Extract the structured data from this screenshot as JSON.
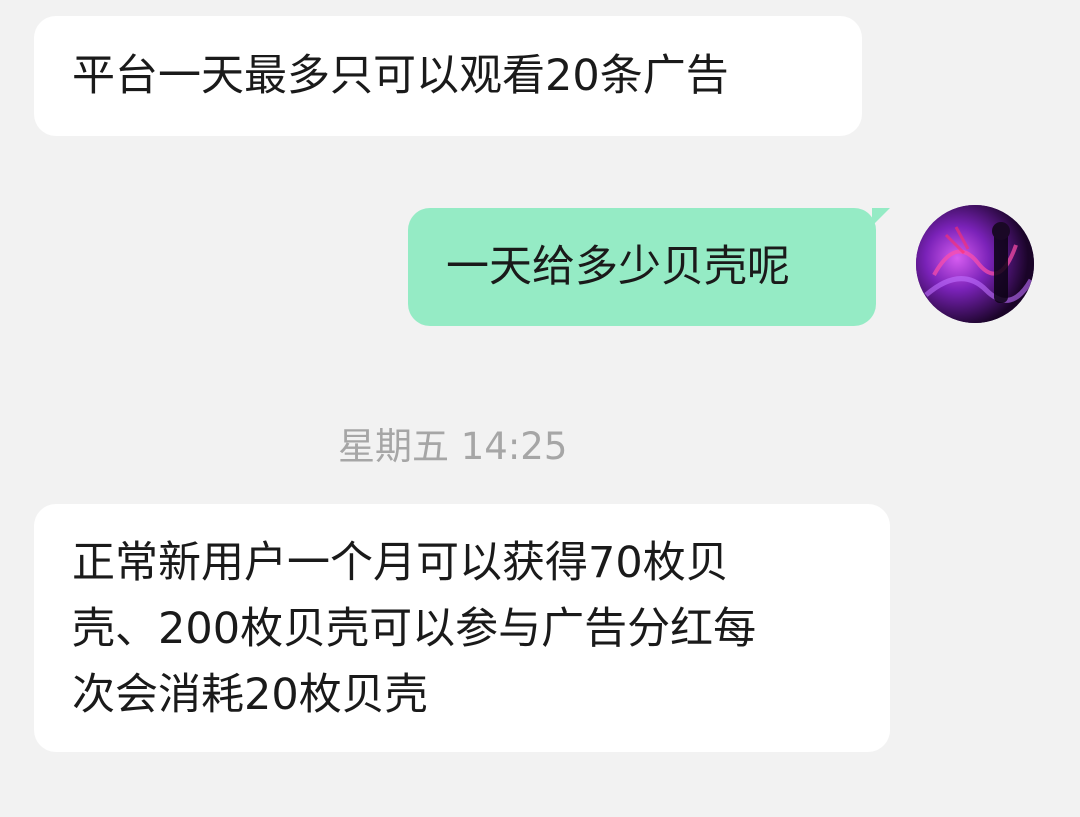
{
  "messages": [
    {
      "direction": "incoming",
      "text": "平台一天最多只可以观看20条广告"
    },
    {
      "direction": "outgoing",
      "text": "一天给多少贝壳呢"
    },
    {
      "direction": "incoming",
      "lines": [
        "正常新用户一个月可以获得70枚贝",
        "壳、200枚贝壳可以参与广告分红每",
        "次会消耗20枚贝壳"
      ]
    }
  ],
  "timestamp": "星期五 14:25",
  "colors": {
    "background": "#f2f2f2",
    "incoming_bubble": "#ffffff",
    "outgoing_bubble": "#95ebc5",
    "timestamp_text": "#a6a6a6"
  },
  "icons": {
    "avatar": "user-avatar-purple-artwork"
  }
}
